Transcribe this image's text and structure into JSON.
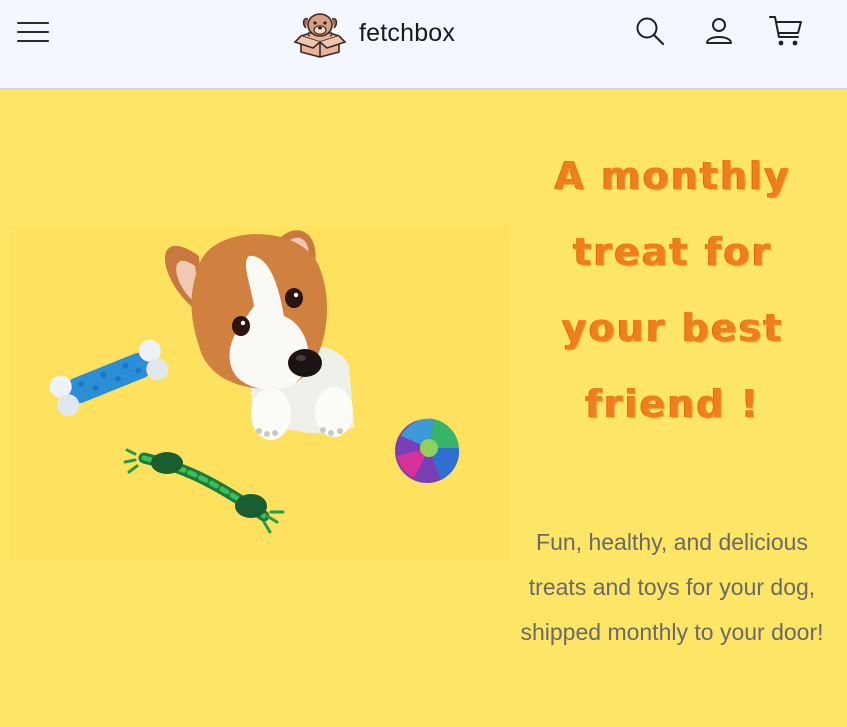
{
  "header": {
    "brand_name": "fetchbox",
    "icons": {
      "menu": "hamburger-menu-icon",
      "logo": "dog-in-box-logo",
      "search": "search-icon",
      "account": "user-icon",
      "cart": "cart-icon"
    }
  },
  "hero": {
    "headline": "A monthly treat for your best friend !",
    "subtext": "Fun, healthy, and delicious treats and toys for your dog, shipped monthly to your door!",
    "image": "corgi-puppy-with-toys"
  },
  "colors": {
    "header_bg": "#f4f7ff",
    "hero_bg": "#fde566",
    "headline": "#ef7f1a",
    "subtext": "#6b6a66"
  }
}
